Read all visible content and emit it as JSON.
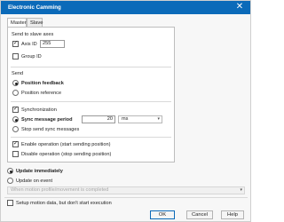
{
  "window": {
    "title": "Electronic Camming",
    "close_glyph": "✕"
  },
  "tabs": [
    {
      "label": "Master"
    },
    {
      "label": "Slave"
    }
  ],
  "send_to_slave": {
    "heading": "Send to slave axes",
    "axis_id_label": "Axis ID",
    "axis_id_value": "255",
    "axis_id_checked": true,
    "group_id_label": "Group ID",
    "group_id_checked": false
  },
  "send": {
    "heading": "Send",
    "options": [
      "Position feedback",
      "Position reference"
    ],
    "selected": "Position feedback"
  },
  "sync": {
    "synchronization_label": "Synchronization",
    "synchronization_checked": true,
    "period_label": "Sync message period",
    "period_value": "20",
    "period_unit": "ms",
    "stop_label": "Stop send sync messages"
  },
  "operation": {
    "enable_label": "Enable operation (start sending position)",
    "enable_checked": true,
    "disable_label": "Disable operation (stop sending position)",
    "disable_checked": false
  },
  "update": {
    "immediately_label": "Update immediately",
    "on_event_label": "Update on event",
    "selected": "Update immediately",
    "event_placeholder": "When motion profile/movement is completed"
  },
  "setup_only": {
    "label": "Setup motion data, but don't start execution"
  },
  "buttons": {
    "ok": "OK",
    "cancel": "Cancel",
    "help": "Help"
  },
  "colors": {
    "title_bar": "#0b6ab9",
    "window_bg": "#f7f7f7",
    "panel_bg": "#ffffff"
  }
}
